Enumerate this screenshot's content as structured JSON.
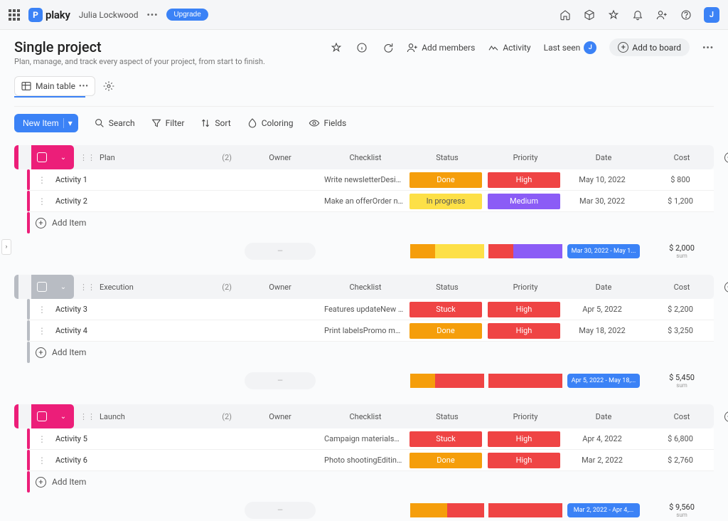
{
  "app": {
    "name": "plaky",
    "logo_letter": "P",
    "user": "Julia Lockwood",
    "upgrade": "Upgrade",
    "avatar_letter": "J"
  },
  "board": {
    "title": "Single project",
    "subtitle": "Plan, manage, and track every aspect of your project, from start to finish.",
    "add_members": "Add members",
    "activity": "Activity",
    "last_seen": "Last seen",
    "last_seen_avatar": "J",
    "add_to_board": "Add to board"
  },
  "tabs": {
    "main": "Main table"
  },
  "toolbar": {
    "new_item": "New Item",
    "search": "Search",
    "filter": "Filter",
    "sort": "Sort",
    "coloring": "Coloring",
    "fields": "Fields"
  },
  "columns": {
    "owner": "Owner",
    "checklist": "Checklist",
    "status": "Status",
    "priority": "Priority",
    "date": "Date",
    "cost": "Cost"
  },
  "status_labels": {
    "done": "Done",
    "in_progress": "In progress",
    "stuck": "Stuck"
  },
  "priority_labels": {
    "high": "High",
    "medium": "Medium"
  },
  "add_item_label": "Add Item",
  "summary": {
    "sum_label": "sum"
  },
  "groups": [
    {
      "name": "Plan",
      "count": "(2)",
      "color_class": "g-pink",
      "rows": [
        {
          "name": "Activity 1",
          "checklist": "Write newsletterDesign r...",
          "status": "done",
          "priority": "high",
          "date": "May 10, 2022",
          "cost": "$ 800"
        },
        {
          "name": "Activity 2",
          "checklist": "Make an offerOrder new l...",
          "status": "in_progress",
          "priority": "medium",
          "date": "Mar 30, 2022",
          "cost": "$ 1,200"
        }
      ],
      "summary": {
        "status_segs": [
          "#f59e0b",
          "#fde047",
          "#fde047"
        ],
        "priority_segs": [
          "#ef4444",
          "#8b5cf6",
          "#8b5cf6"
        ],
        "date": "Mar 30, 2022 - May 1...",
        "cost": "$ 2,000"
      }
    },
    {
      "name": "Execution",
      "count": "(2)",
      "color_class": "g-gray",
      "rows": [
        {
          "name": "Activity 3",
          "checklist": "Features updateNew tec...",
          "status": "stuck",
          "priority": "high",
          "date": "Apr 5, 2022",
          "cost": "$ 2,200"
        },
        {
          "name": "Activity 4",
          "checklist": "Print labelsPromo materi...",
          "status": "done",
          "priority": "high",
          "date": "May 18, 2022",
          "cost": "$ 3,250"
        }
      ],
      "summary": {
        "status_segs": [
          "#f59e0b",
          "#ef4444",
          "#ef4444"
        ],
        "priority_segs": [
          "#ef4444"
        ],
        "date": "Apr 5, 2022 - May 18,...",
        "cost": "$ 5,450"
      }
    },
    {
      "name": "Launch",
      "count": "(2)",
      "color_class": "g-pink",
      "rows": [
        {
          "name": "Activity 5",
          "checklist": "Campaign materialsUpd...",
          "status": "stuck",
          "priority": "high",
          "date": "Apr 4, 2022",
          "cost": "$ 6,800"
        },
        {
          "name": "Activity 6",
          "checklist": "Photo shootingEditingLa...",
          "status": "done",
          "priority": "high",
          "date": "Mar 2, 2022",
          "cost": "$ 2,760"
        }
      ],
      "summary": {
        "status_segs": [
          "#f59e0b",
          "#ef4444"
        ],
        "priority_segs": [
          "#ef4444"
        ],
        "date": "Mar 2, 2022 - Apr 4,...",
        "cost": "$ 9,560"
      }
    }
  ]
}
